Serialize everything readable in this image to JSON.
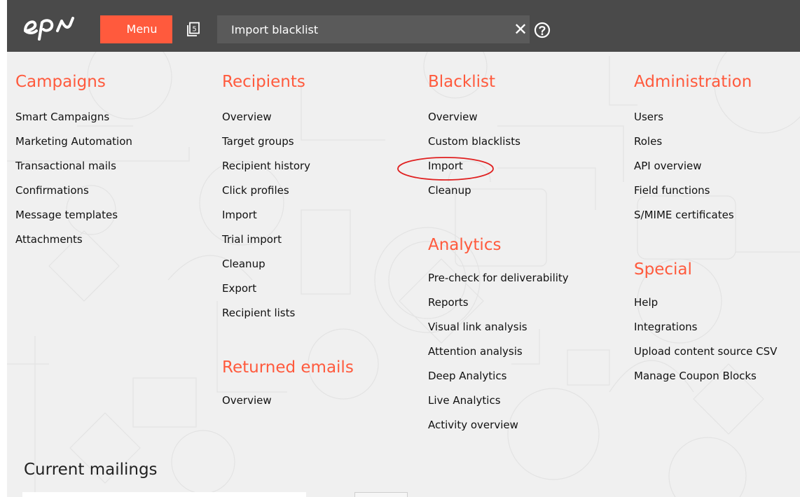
{
  "header": {
    "menu_label": "Menu",
    "tab_count": "5",
    "search": {
      "value": "Import blacklist",
      "placeholder": ""
    },
    "clear_glyph": "✕"
  },
  "columns": {
    "campaigns": {
      "heading": "Campaigns",
      "links": [
        "Smart Campaigns",
        "Marketing Automation",
        "Transactional mails",
        "Confirmations",
        "Message templates",
        "Attachments"
      ]
    },
    "recipients": {
      "heading": "Recipients",
      "links": [
        "Overview",
        "Target groups",
        "Recipient history",
        "Click profiles",
        "Import",
        "Trial import",
        "Cleanup",
        "Export",
        "Recipient lists"
      ]
    },
    "returned_emails": {
      "heading": "Returned emails",
      "links": [
        "Overview"
      ]
    },
    "blacklist": {
      "heading": "Blacklist",
      "links": [
        "Overview",
        "Custom blacklists",
        "Import",
        "Cleanup"
      ]
    },
    "analytics": {
      "heading": "Analytics",
      "links": [
        "Pre-check for deliverability",
        "Reports",
        "Visual link analysis",
        "Attention analysis",
        "Deep Analytics",
        "Live Analytics",
        "Activity overview"
      ]
    },
    "administration": {
      "heading": "Administration",
      "links": [
        "Users",
        "Roles",
        "API overview",
        "Field functions",
        "S/MIME certificates"
      ]
    },
    "special": {
      "heading": "Special",
      "links": [
        "Help",
        "Integrations",
        "Upload content source CSV",
        "Manage Coupon Blocks"
      ]
    }
  },
  "current_mailings": {
    "heading": "Current mailings"
  },
  "colors": {
    "accent": "#ff5a3d",
    "topbar": "#4a4a4a",
    "search_bg": "#5a5a5a",
    "page_bg": "#f0f0f0",
    "text": "#111111"
  },
  "icons": [
    "epi-logo",
    "tabs-icon",
    "clear-icon",
    "help-icon"
  ]
}
